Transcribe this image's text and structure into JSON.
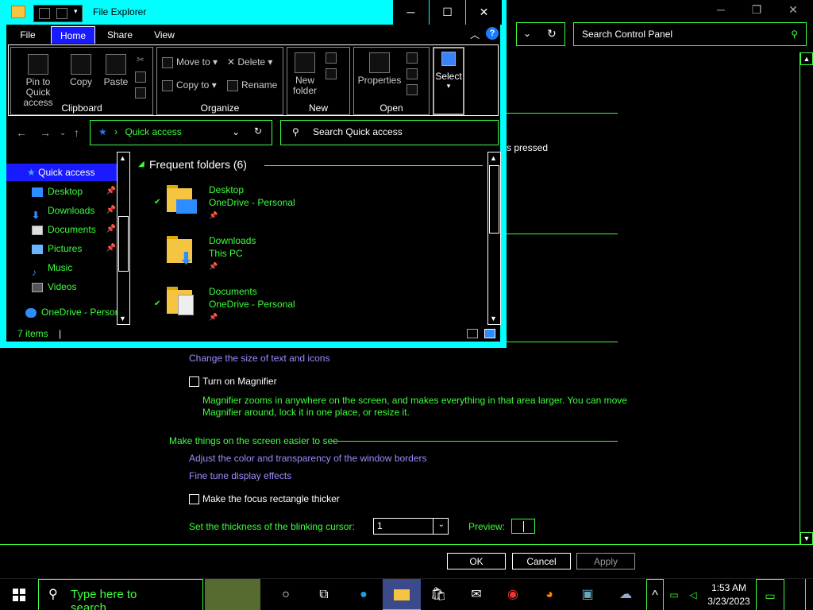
{
  "control_panel": {
    "search_placeholder": "Search Control Panel",
    "partial_text": "s pressed",
    "link_text_size": "Change the size of text and icons",
    "magnifier_label": "Turn on Magnifier",
    "magnifier_desc_1": "Magnifier zooms in anywhere on the screen, and makes everything in that area larger. You can move",
    "magnifier_desc_2": "Magnifier around, lock it in one place, or resize it.",
    "section_heading": "Make things on the screen easier to see",
    "link_window_borders": "Adjust the color and transparency of the window borders",
    "link_display_effects": "Fine tune display effects",
    "focus_label": "Make the focus rectangle thicker",
    "cursor_label": "Set the thickness of the blinking cursor:",
    "cursor_value": "1",
    "preview_label": "Preview:",
    "ok": "OK",
    "cancel": "Cancel",
    "apply": "Apply",
    "window_controls": {
      "minimize": "─",
      "restore": "❐",
      "close": "✕"
    },
    "refresh_icon": "↻"
  },
  "file_explorer": {
    "title": "File Explorer",
    "window_controls": {
      "minimize": "─",
      "maximize": "☐",
      "close": "✕"
    },
    "tabs": [
      "File",
      "Home",
      "Share",
      "View"
    ],
    "ribbon": {
      "clipboard": {
        "label": "Clipboard",
        "pin": "Pin to Quick access",
        "copy": "Copy",
        "paste": "Paste"
      },
      "organize": {
        "label": "Organize",
        "move_to": "Move to",
        "copy_to": "Copy to",
        "delete": "Delete",
        "rename": "Rename"
      },
      "new": {
        "label": "New",
        "new_folder": "New folder"
      },
      "open": {
        "label": "Open",
        "properties": "Properties"
      },
      "select": {
        "label": "Select"
      }
    },
    "address": "Quick access",
    "search_placeholder": "Search Quick access",
    "nav": [
      {
        "label": "Quick access",
        "pinned": false
      },
      {
        "label": "Desktop",
        "pinned": true
      },
      {
        "label": "Downloads",
        "pinned": true
      },
      {
        "label": "Documents",
        "pinned": true
      },
      {
        "label": "Pictures",
        "pinned": true
      },
      {
        "label": "Music",
        "pinned": false
      },
      {
        "label": "Videos",
        "pinned": false
      },
      {
        "label": "OneDrive - Personal",
        "pinned": false
      }
    ],
    "frequent_header": "Frequent folders (6)",
    "folders": [
      {
        "name": "Desktop",
        "location": "OneDrive - Personal"
      },
      {
        "name": "Downloads",
        "location": "This PC"
      },
      {
        "name": "Documents",
        "location": "OneDrive - Personal"
      }
    ],
    "status": "7 items"
  },
  "taskbar": {
    "search_placeholder": "Type here to search",
    "time": "1:53 AM",
    "date": "3/23/2023"
  },
  "colors": {
    "accent": "#3cff3c",
    "link": "#9a8cff",
    "explorer_frame": "#00ffff",
    "selection": "#1a1aff"
  }
}
